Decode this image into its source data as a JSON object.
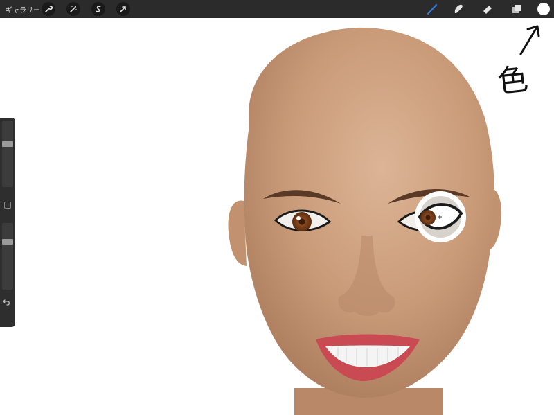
{
  "topbar": {
    "gallery_label": "ギャラリー",
    "left_tools": [
      {
        "icon": "wrench-icon",
        "name": "actions"
      },
      {
        "icon": "magic-wand-icon",
        "name": "adjustments"
      },
      {
        "icon": "selection-icon",
        "name": "selection"
      },
      {
        "icon": "transform-arrow-icon",
        "name": "transform"
      }
    ],
    "right_tools": [
      {
        "icon": "brush-icon",
        "name": "brush",
        "active": true
      },
      {
        "icon": "smudge-icon",
        "name": "smudge"
      },
      {
        "icon": "eraser-icon",
        "name": "eraser"
      },
      {
        "icon": "layers-icon",
        "name": "layers"
      }
    ],
    "color_button": {
      "icon": "color-circle-icon",
      "color": "#ffffff"
    }
  },
  "sidebar": {
    "brush_size_level": 0.34,
    "opacity_level": 0.26,
    "undo_icon": "undo-icon"
  },
  "annotation": {
    "text": "色",
    "arrow_icon": "arrow-up-right-icon"
  },
  "colors": {
    "topbar": "#2b2b2b",
    "active_brush": "#2f7de1",
    "skin": "#c99a78"
  }
}
